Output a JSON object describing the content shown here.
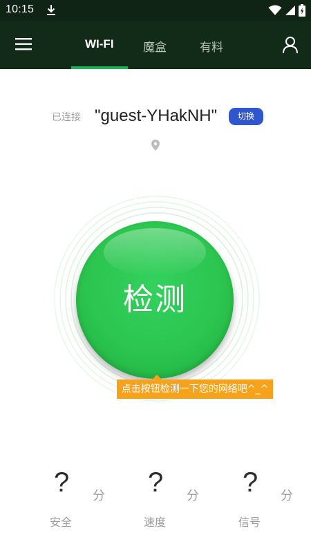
{
  "status_bar": {
    "time": "10:15"
  },
  "nav": {
    "tabs": [
      {
        "label": "WI-FI",
        "active": true
      },
      {
        "label": "魔盒",
        "active": false
      },
      {
        "label": "有料",
        "active": false
      }
    ]
  },
  "connection": {
    "label": "已连接",
    "ssid": "\"guest-YHakNH\"",
    "switch_label": "切换"
  },
  "detect": {
    "button_label": "检测",
    "tooltip": "点击按钮检测一下您的网络吧^_^"
  },
  "scores": [
    {
      "value": "?",
      "unit": "分",
      "label": "安全"
    },
    {
      "value": "?",
      "unit": "分",
      "label": "速度"
    },
    {
      "value": "?",
      "unit": "分",
      "label": "信号"
    }
  ],
  "colors": {
    "status_bar_bg": "#102416",
    "nav_bg": "#122a18",
    "tab_indicator": "#21b25b",
    "detect_button": "#2bc54f",
    "switch_button": "#2f56cf",
    "tooltip_bg": "#f7a21b"
  },
  "icons": {
    "status_left": "download-icon",
    "status_right": [
      "wifi-icon",
      "cellular-signal-icon",
      "battery-icon"
    ],
    "nav_left": "hamburger-menu-icon",
    "nav_right": "user-icon",
    "connection": "location-pin-icon"
  }
}
